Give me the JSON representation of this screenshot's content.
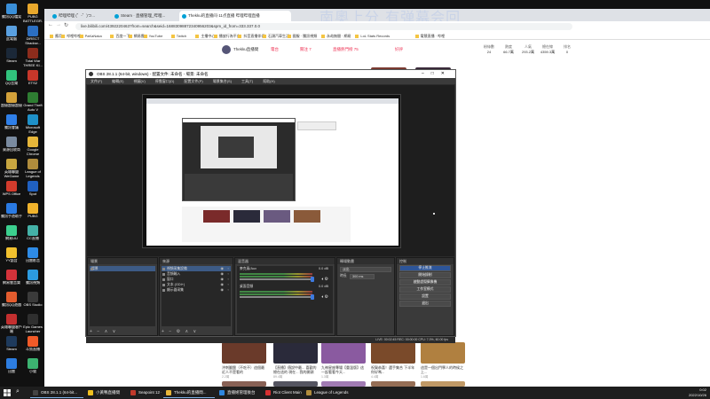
{
  "desktop": {
    "icons": [
      {
        "label": "騰訊QQ檔案",
        "color": "#3a8fd8"
      },
      {
        "label": "PUBG BATTLEGR.",
        "color": "#e8a82c"
      },
      {
        "label": "此電腦",
        "color": "#5aa0e0"
      },
      {
        "label": "DiRECT Shadow...",
        "color": "#2b6fc2"
      },
      {
        "label": "Steam",
        "color": "#1b2838"
      },
      {
        "label": "Total War THREE KI...",
        "color": "#8c2c1c"
      },
      {
        "label": "QQ音樂",
        "color": "#31c27c"
      },
      {
        "label": "ETS2",
        "color": "#c7372a"
      },
      {
        "label": "超級超級超級",
        "color": "#d3a13a"
      },
      {
        "label": "Grand Theft Auto V",
        "color": "#2e7d32"
      },
      {
        "label": "騰訊會議",
        "color": "#2f7fe8"
      },
      {
        "label": "Microsoft Edge",
        "color": "#1e90c8"
      },
      {
        "label": "資源回收筒",
        "color": "#7a8ba0"
      },
      {
        "label": "Google Chrome",
        "color": "#e6b63a"
      },
      {
        "label": "英雄聯盟WeGame",
        "color": "#c8a640"
      },
      {
        "label": "League of Legends",
        "color": "#b08c3c"
      },
      {
        "label": "WPS Office",
        "color": "#d23b2c"
      },
      {
        "label": "Spot",
        "color": "#2060c0"
      },
      {
        "label": "騰訊手遊助手",
        "color": "#2a7ae2"
      },
      {
        "label": "PUBG",
        "color": "#f0b32c"
      },
      {
        "label": "網易UU",
        "color": "#3ccf8e"
      },
      {
        "label": "CC直播",
        "color": "#44b1a7"
      },
      {
        "label": "YY語音",
        "color": "#f2c12e"
      },
      {
        "label": "迅雷影音",
        "color": "#2e8be6"
      },
      {
        "label": "網易雲音樂",
        "color": "#d4323a"
      },
      {
        "label": "騰訊視頻",
        "color": "#2c9be0"
      },
      {
        "label": "騰訊QQ遊戲",
        "color": "#e35c2e"
      },
      {
        "label": "OBS Studio",
        "color": "#3a3a3a"
      },
      {
        "label": "英雄聯盟客戶端",
        "color": "#c32f2f"
      },
      {
        "label": "Epic Games Launcher",
        "color": "#2f2f2f"
      },
      {
        "label": "Steam",
        "color": "#1e3a5c"
      },
      {
        "label": "斗魚直播",
        "color": "#f05a28"
      },
      {
        "label": "迅雷",
        "color": "#2d7de0"
      },
      {
        "label": "小號",
        "color": "#3cb371"
      }
    ]
  },
  "browser": {
    "tabs": [
      {
        "label": "哔哩哔哩 (゜-゜)つ...",
        "active": false
      },
      {
        "label": "Steam · 直播管理_哔哩...",
        "active": false
      },
      {
        "label": "Thekku的直播间·11点直播 哔哩哔哩直播",
        "active": true
      }
    ],
    "url": "live.bilibili.com/4392220463?from=search&seid=16883098872340956203&spm_id_from=333.337.0.0",
    "bookmarks": [
      "應用",
      "哔哩哔哩",
      "PaKaNaka",
      "百度一下",
      "網易雲",
      "YouTube",
      "Twitch",
      "主播中心",
      "播放行為平台",
      "抖音直播伴侶",
      "石頭汽車生活",
      "國服 · 騰訊視頻",
      "永劫無間 · 網易",
      "LoL Stats Records",
      "電競直播 · 哔哩"
    ],
    "banner": "南奧上分 有弹幕会回"
  },
  "live_page": {
    "streamer_bar": [
      {
        "label": "Thekku直播間",
        "color": "#333"
      },
      {
        "label": "電台",
        "color": "#e35"
      },
      {
        "label": "關注 7",
        "color": "#e35"
      },
      {
        "label": "直播熱門榜 75",
        "color": "#e35"
      },
      {
        "label": "好評",
        "color": "#e35"
      }
    ],
    "stats": [
      {
        "label": "粉絲數",
        "value": "24"
      },
      {
        "label": "熱度",
        "value": "66.7萬"
      },
      {
        "label": "人氣",
        "value": "293.2萬"
      },
      {
        "label": "總在線",
        "value": "4359.3萬"
      },
      {
        "label": "排名",
        "value": "0"
      }
    ],
    "cards": [
      {
        "title": "沖刺翻盤（不吃不）這個最近人不是看的",
        "meta": "2.2萬",
        "thumb": "#6a3a2a"
      },
      {
        "title": "【直播】傳說中最... 喜歡的總在這的 現在... 我的開頭",
        "meta": "89.4萬",
        "thumb": "#2a2a3a"
      },
      {
        "title": "九神星座專場【重溫版】這一起看看今天...",
        "meta": "1.3萬",
        "thumb": "#8a5aa0"
      },
      {
        "title": "祝賀恭喜！選手集合 下半年你好嗎...",
        "meta": "4.4萬",
        "thumb": "#7a4a2a"
      },
      {
        "title": "這是一個出門學人的時候之上...",
        "meta": "1.6萬",
        "thumb": "#b08040"
      }
    ]
  },
  "obs": {
    "title": "OBS 28.1.1 (64-bit, windows) - 配置文件: 未命名 - 場景: 未命名",
    "menu": [
      "文件(F)",
      "編輯(E)",
      "視圖(V)",
      "停靠窗口(D)",
      "配置文件(P)",
      "場景集合(S)",
      "工具(T)",
      "幫助(H)"
    ],
    "docks": {
      "scenes": {
        "title": "場景",
        "items": [
          "場景"
        ]
      },
      "sources": {
        "title": "來源",
        "items": [
          "視頻采集設備",
          "音頻輸入",
          "窗口",
          "文本 (GDI+)",
          "顯示器采集"
        ]
      },
      "mixer": {
        "title": "混音器",
        "channels": [
          {
            "name": "麥克風/Aux",
            "db": "0.0 dB"
          },
          {
            "name": "桌面音頻",
            "db": "0.0 dB"
          }
        ]
      },
      "transitions": {
        "title": "轉場動畫",
        "type": "淡出",
        "duration_label": "時長",
        "duration": "300 ms"
      },
      "controls": {
        "title": "控制",
        "buttons": [
          {
            "label": "停止推流",
            "active": true
          },
          {
            "label": "開始錄制",
            "active": false
          },
          {
            "label": "啟動虛擬攝像機",
            "active": false
          },
          {
            "label": "工作室模式",
            "active": false
          },
          {
            "label": "設置",
            "active": false
          },
          {
            "label": "退出",
            "active": false
          }
        ]
      }
    },
    "status": "LIVE: 00:02:45   REC: 00:00:00   CPU: 7.0%, 60.00 fps"
  },
  "taskbar": {
    "apps": [
      {
        "label": "OBS 28.1.1 (64-bit...",
        "color": "#444",
        "open": true
      },
      {
        "label": "小黃鴨直播間",
        "color": "#f0c020",
        "open": false
      },
      {
        "label": "Seapoint 12 - Win...",
        "color": "#c0392b",
        "open": false
      },
      {
        "label": "Thekku的直播間...",
        "color": "#e6b63a",
        "open": true
      },
      {
        "label": "直播姬管理後台",
        "color": "#2e86de",
        "open": false
      },
      {
        "label": "Riot Client Main",
        "color": "#d63031",
        "open": false
      },
      {
        "label": "League of Legends",
        "color": "#b08c3c",
        "open": false
      }
    ],
    "time": "0:02",
    "date": "2022/10/26"
  }
}
